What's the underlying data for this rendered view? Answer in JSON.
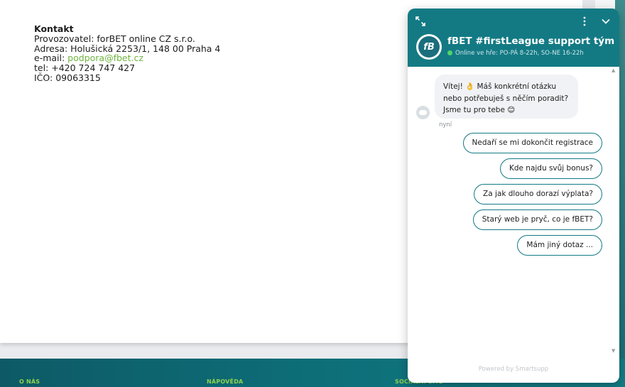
{
  "contact": {
    "heading": "Kontakt",
    "operator": "Provozovatel: forBET online CZ s.r.o.",
    "address": "Adresa: Holušická 2253/1, 148 00 Praha 4",
    "email_label": "e-mail: ",
    "email": "podpora@fbet.cz",
    "phone": "tel: +420 724 747 427",
    "ico": "IČO: 09063315"
  },
  "footer": {
    "col1": "O NÁS",
    "col2": "NÁPOVĚDA",
    "col3": "SOCIÁLNÍ SÍTĚ"
  },
  "chat": {
    "logo_text": "fB",
    "team_name": "fBET #firstLeague support tým",
    "status": "Online ve hře: PO-PÁ 8-22h, SO-NE 16-22h",
    "status_color": "#4fd36b",
    "header_color": "#137a84",
    "message": {
      "line1": "Vítej! 👌 Máš konkrétní otázku",
      "line2": "nebo potřebuješ s něčím poradit?",
      "line3": "Jsme tu pro tebe 😊"
    },
    "message_time": "nyní",
    "quick_replies": [
      "Nedaří se mi dokončit registrace",
      "Kde najdu svůj bonus?",
      "Za jak dlouho dorazí výplata?",
      "Starý web je pryč, co je fBET?",
      "Mám jiný dotaz ..."
    ],
    "powered_by": "Powered by Smartsupp"
  }
}
